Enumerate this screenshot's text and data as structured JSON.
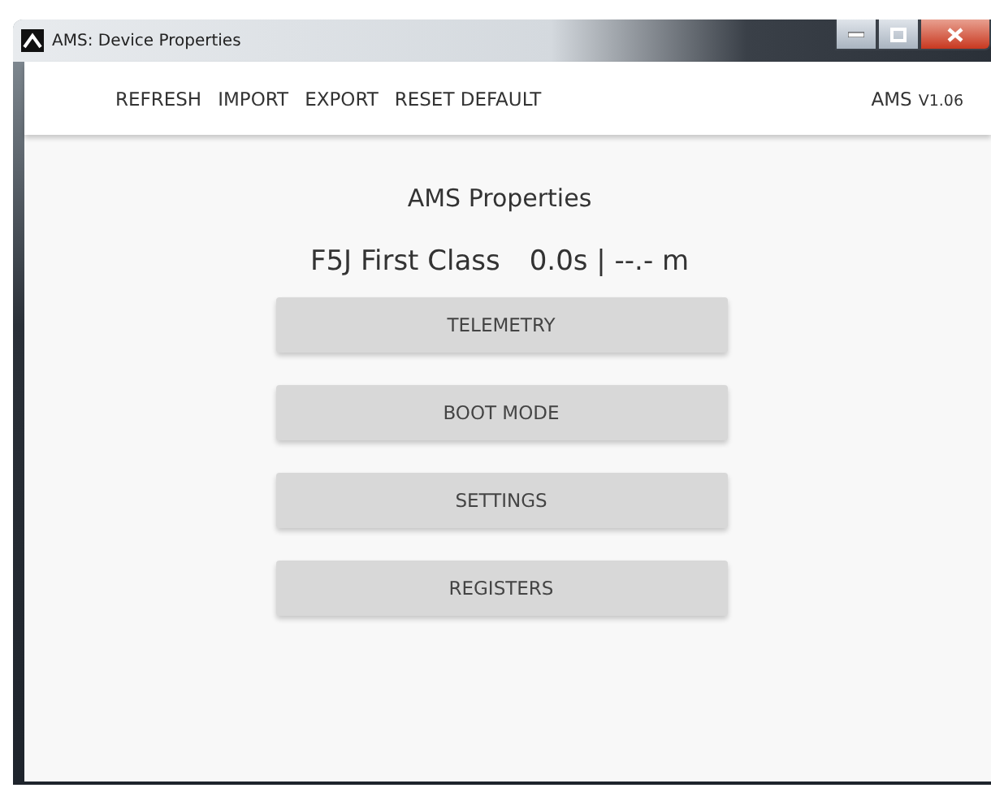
{
  "window": {
    "title": "AMS: Device Properties"
  },
  "toolbar": {
    "items": [
      "REFRESH",
      "IMPORT",
      "EXPORT",
      "RESET DEFAULT"
    ],
    "brand": "AMS",
    "version": "V1.06"
  },
  "heading": "AMS Properties",
  "status": {
    "model": "F5J First Class",
    "reading": "0.0s | --.- m"
  },
  "buttons": [
    "TELEMETRY",
    "BOOT MODE",
    "SETTINGS",
    "REGISTERS"
  ]
}
